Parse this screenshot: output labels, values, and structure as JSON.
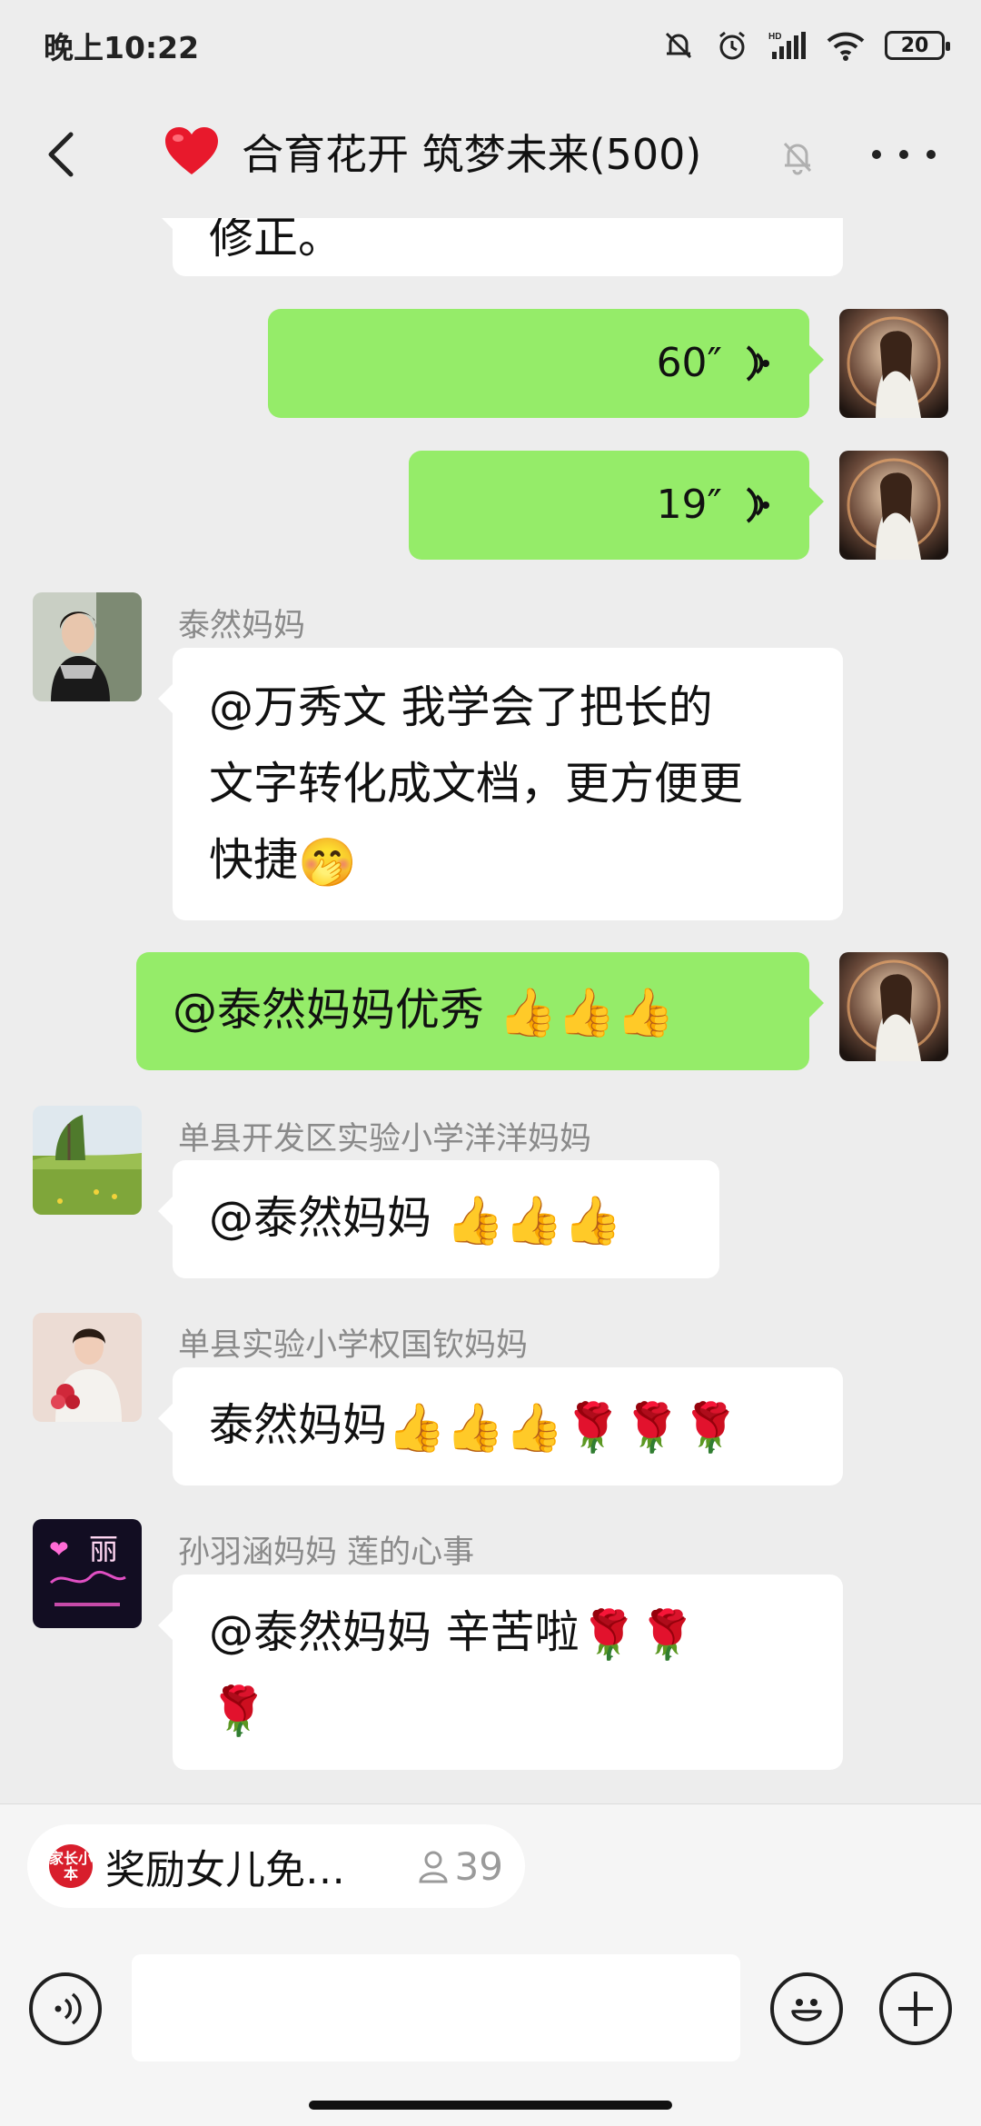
{
  "status_bar": {
    "time": "晚上10:22",
    "battery": "20"
  },
  "header": {
    "title": "合育花开 筑梦未来(500)"
  },
  "messages": {
    "m0": {
      "text": "修正。"
    },
    "m1": {
      "duration": "60″"
    },
    "m2": {
      "duration": "19″"
    },
    "m3": {
      "sender": "泰然妈妈",
      "line1": "@万秀文  我学会了把长的",
      "line2": "文字转化成文档，更方便更",
      "line3": "快捷",
      "emoji": "🤭"
    },
    "m4": {
      "text": "@泰然妈妈优秀 ",
      "emoji": "👍👍👍"
    },
    "m5": {
      "sender": "单县开发区实验小学洋洋妈妈",
      "text": "@泰然妈妈 ",
      "emoji": "👍👍👍"
    },
    "m6": {
      "sender": "单县实验小学权国钦妈妈",
      "text": "泰然妈妈",
      "emoji": "👍👍👍🌹🌹🌹"
    },
    "m7": {
      "sender": "孙羽涵妈妈  莲的心事",
      "line1": "@泰然妈妈  辛苦啦",
      "emoji1": "🌹🌹",
      "emoji2": "🌹"
    }
  },
  "bottom": {
    "pill": {
      "logo": "家长小本",
      "text": "奖励女儿免…",
      "count": "39"
    },
    "input_placeholder": ""
  },
  "avatars": {
    "self": "avatar-girl",
    "m3": "avatar-woman",
    "m5": "avatar-landscape",
    "m6": "avatar-woman-flowers",
    "m7": "avatar-neon-li"
  }
}
